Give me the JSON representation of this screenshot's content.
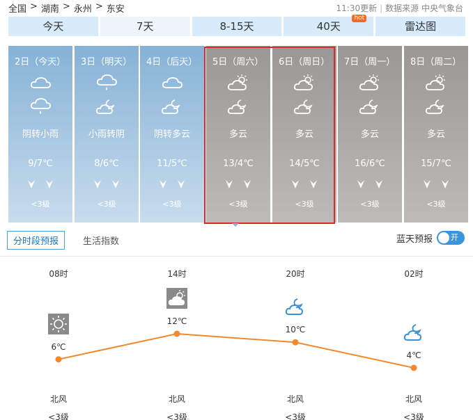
{
  "breadcrumb": [
    "全国",
    "湖南",
    "永州",
    "东安"
  ],
  "breadcrumb_sep": ">",
  "update_time": "11:30更新",
  "data_source": "数据来源 中央气象台",
  "tabs": [
    {
      "label": "今天"
    },
    {
      "label": "7天"
    },
    {
      "label": "8-15天"
    },
    {
      "label": "40天",
      "badge": "hot"
    },
    {
      "label": "雷达图"
    }
  ],
  "days": [
    {
      "date": "2日（今天）",
      "icon_day": "cloud-icon",
      "icon_night": "rain-cloud-icon",
      "cond": "阴转小雨",
      "temp": "9/7℃",
      "wind": "<3级",
      "bg_top": "#86b2d6",
      "bg_bottom": "#c8dced"
    },
    {
      "date": "3日（明天）",
      "icon_day": "rain-cloud-icon",
      "icon_night": "cloud-moon-icon",
      "cond": "小雨转阴",
      "temp": "8/6℃",
      "wind": "<3级",
      "bg_top": "#86b2d6",
      "bg_bottom": "#c8dced"
    },
    {
      "date": "4日（后天）",
      "icon_day": "cloud-icon",
      "icon_night": "cloud-moon-icon",
      "cond": "阴转多云",
      "temp": "11/5℃",
      "wind": "<3级",
      "bg_top": "#86b2d6",
      "bg_bottom": "#c8dced"
    },
    {
      "date": "5日（周六）",
      "icon_day": "sun-cloud-icon",
      "icon_night": "cloud-moon-icon",
      "cond": "多云",
      "temp": "13/4℃",
      "wind": "<3级",
      "bg_top": "#9a9894",
      "bg_bottom": "#bdbbb7"
    },
    {
      "date": "6日（周日）",
      "icon_day": "sun-cloud-icon",
      "icon_night": "cloud-moon-icon",
      "cond": "多云",
      "temp": "14/5℃",
      "wind": "<3级",
      "bg_top": "#9a9894",
      "bg_bottom": "#bdbbb7"
    },
    {
      "date": "7日（周一）",
      "icon_day": "sun-cloud-icon",
      "icon_night": "cloud-moon-icon",
      "cond": "多云",
      "temp": "16/6℃",
      "wind": "<3级",
      "bg_top": "#9a9894",
      "bg_bottom": "#bdbbb7"
    },
    {
      "date": "8日（周二）",
      "icon_day": "sun-cloud-icon",
      "icon_night": "cloud-moon-icon",
      "cond": "多云",
      "temp": "15/7℃",
      "wind": "<3级",
      "bg_top": "#9a9894",
      "bg_bottom": "#bdbbb7"
    }
  ],
  "subtabs": [
    {
      "label": "分时段预报"
    },
    {
      "label": "生活指数"
    }
  ],
  "blue_sky": {
    "label": "蓝天预报",
    "toggle_label": "开"
  },
  "hourly": [
    {
      "time": "08时",
      "temp": "6℃",
      "temp_value": 6,
      "icon": "sun-icon",
      "wind_dir": "北风",
      "wind_level": "<3级"
    },
    {
      "time": "14时",
      "temp": "12℃",
      "temp_value": 12,
      "icon": "sun-cloud-icon",
      "wind_dir": "北风",
      "wind_level": "<3级"
    },
    {
      "time": "20时",
      "temp": "10℃",
      "temp_value": 10,
      "icon": "cloud-moon-icon",
      "wind_dir": "北风",
      "wind_level": "<3级"
    },
    {
      "time": "02时",
      "temp": "4℃",
      "temp_value": 4,
      "icon": "cloud-moon-icon",
      "wind_dir": "北风",
      "wind_level": "<3级"
    }
  ],
  "colors": {
    "accent": "#3c95dc",
    "line": "#f08a2c",
    "highlight": "#e0252b",
    "tab_bg": "#d7ebfa"
  }
}
